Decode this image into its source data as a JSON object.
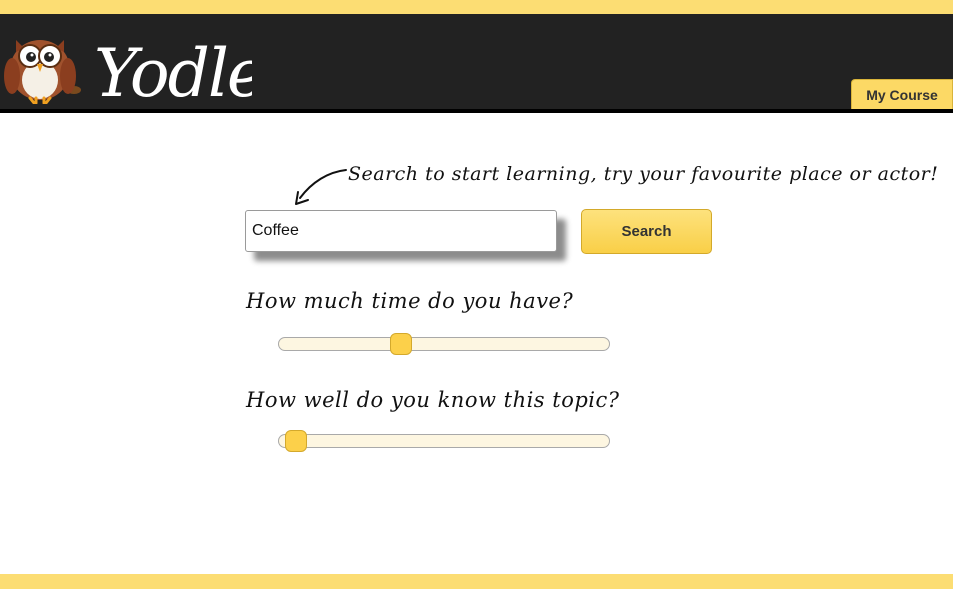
{
  "header": {
    "brand": "Yodle",
    "logo_icon": "owl-logo-icon",
    "my_course_label": "My Course"
  },
  "search": {
    "hint": "Search to start learning, try your favourite place or actor!",
    "hint_icon": "curved-arrow-icon",
    "value": "Coffee",
    "button_label": "Search"
  },
  "sliders": {
    "time": {
      "question": "How much time do you have?",
      "value": 0.37
    },
    "knowledge": {
      "question": "How well do you know this topic?",
      "value": 0.05
    }
  },
  "colors": {
    "accent": "#fcdd73",
    "button": "#fcd04a",
    "header_bg": "#222222",
    "track": "#fdf6e1"
  }
}
